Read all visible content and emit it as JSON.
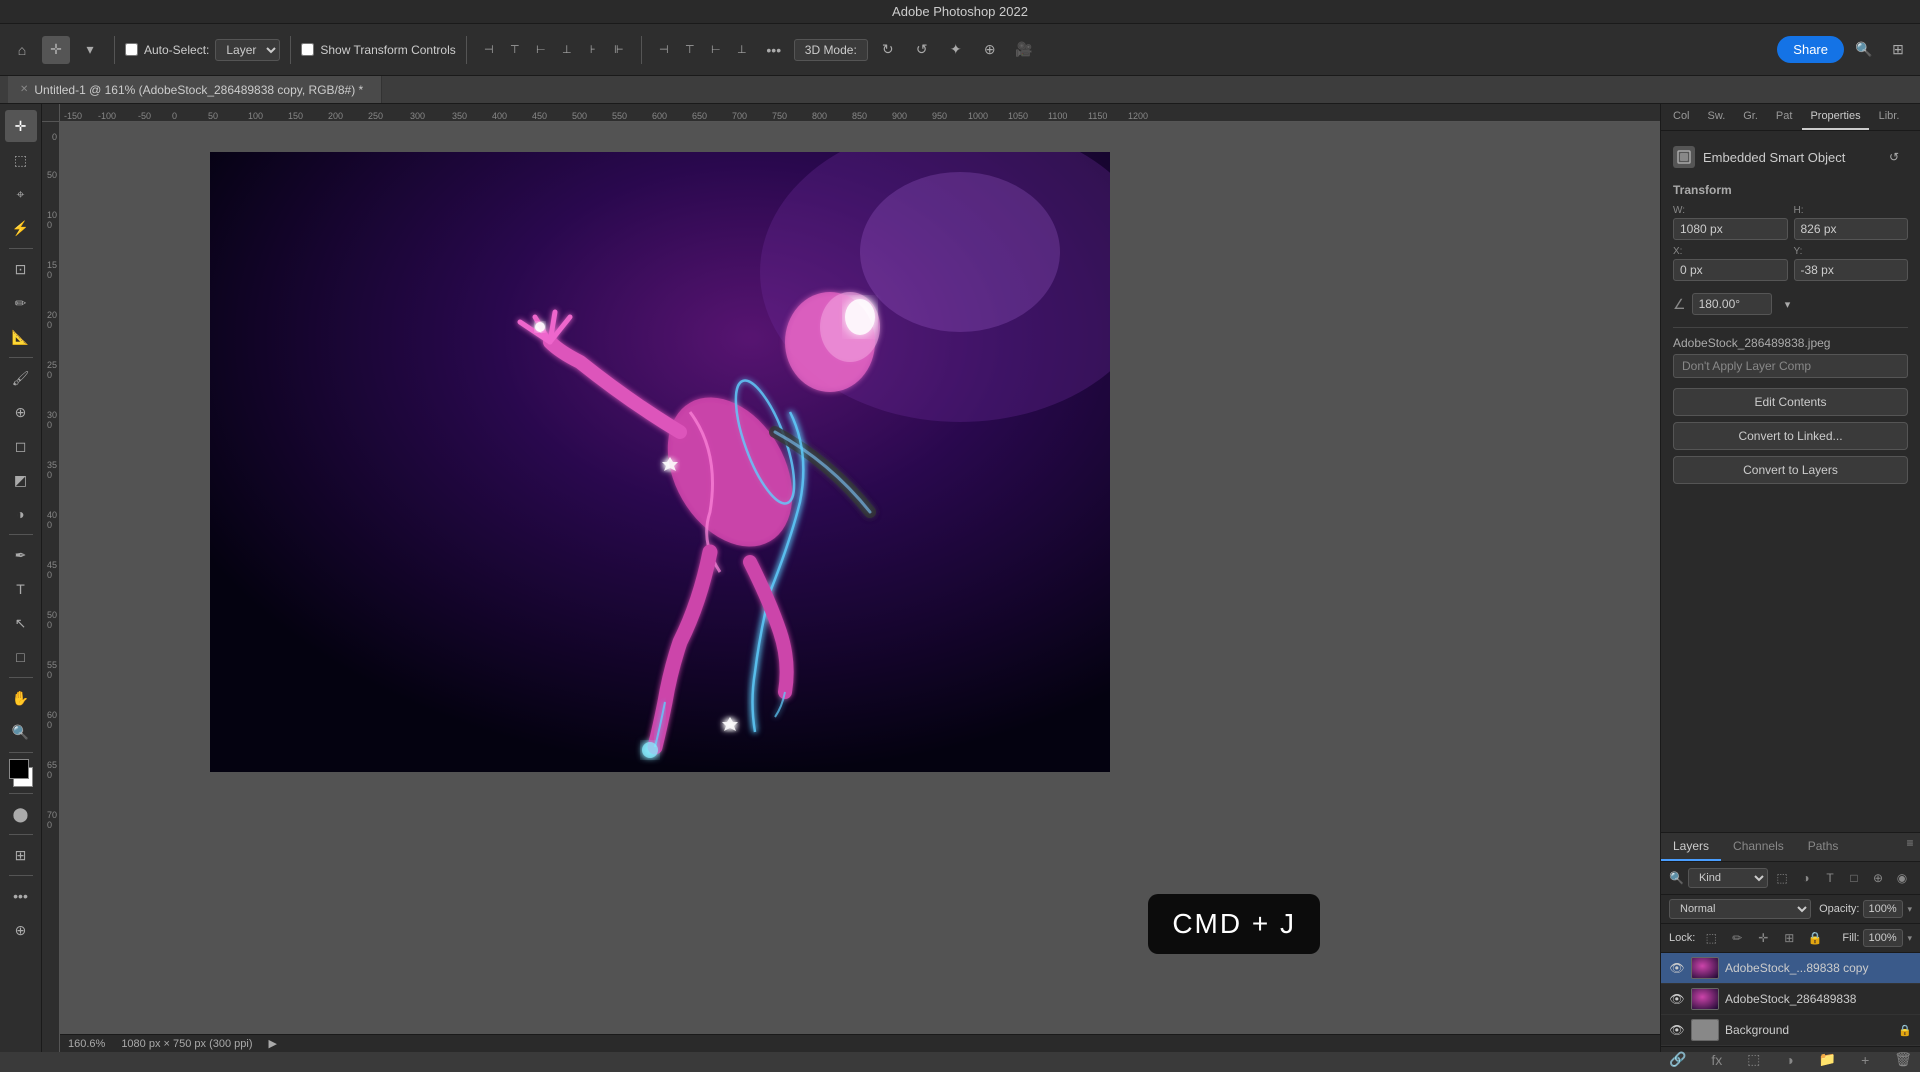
{
  "app": {
    "title": "Adobe Photoshop 2022",
    "tab_title": "Untitled-1 @ 161% (AdobeStock_286489838 copy, RGB/8#) *"
  },
  "toolbar": {
    "auto_select_label": "Auto-Select:",
    "layer_select": "Layer",
    "show_transform": "Show Transform Controls",
    "mode_3d": "3D Mode:",
    "share_label": "Share",
    "search_icon": "🔍",
    "workspace_icon": "⊞",
    "align_icons": [
      "⊣",
      "⊤",
      "⊢",
      "⊥",
      "⊦",
      "⊩"
    ]
  },
  "panel_tabs_top": {
    "items": [
      {
        "label": "Col",
        "active": false
      },
      {
        "label": "Sw.",
        "active": false
      },
      {
        "label": "Gr.",
        "active": false
      },
      {
        "label": "Pat",
        "active": false
      },
      {
        "label": "Properties",
        "active": true
      },
      {
        "label": "Libr.",
        "active": false
      }
    ]
  },
  "properties": {
    "object_type": "Embedded Smart Object",
    "transform_section": "Transform",
    "width_label": "W:",
    "width_value": "1080 px",
    "height_label": "H:",
    "height_value": "826 px",
    "x_label": "X:",
    "x_value": "0 px",
    "y_label": "Y:",
    "y_value": "-38 px",
    "angle_label": "",
    "angle_value": "180.00°",
    "file_name": "AdobeStock_286489838.jpeg",
    "layer_comp_placeholder": "Don't Apply Layer Comp",
    "btn_edit_contents": "Edit Contents",
    "btn_convert_linked": "Convert to Linked...",
    "btn_convert_layers": "Convert to Layers"
  },
  "layers": {
    "tabs": [
      {
        "label": "Layers",
        "active": true
      },
      {
        "label": "Channels",
        "active": false
      },
      {
        "label": "Paths",
        "active": false
      }
    ],
    "filter_label": "Kind",
    "blend_mode": "Normal",
    "opacity_label": "Opacity:",
    "opacity_value": "100%",
    "lock_label": "Lock:",
    "fill_label": "Fill:",
    "fill_value": "100%",
    "items": [
      {
        "name": "AdobeStock_...89838 copy",
        "visible": true,
        "active": true,
        "locked": false,
        "type": "smart"
      },
      {
        "name": "AdobeStock_286489838",
        "visible": true,
        "active": false,
        "locked": false,
        "type": "smart"
      },
      {
        "name": "Background",
        "visible": true,
        "active": false,
        "locked": true,
        "type": "background"
      }
    ]
  },
  "status_bar": {
    "zoom": "160.6%",
    "dimensions": "1080 px × 750 px (300 ppi)"
  },
  "kbd_shortcut": {
    "display": "CMD + J"
  }
}
